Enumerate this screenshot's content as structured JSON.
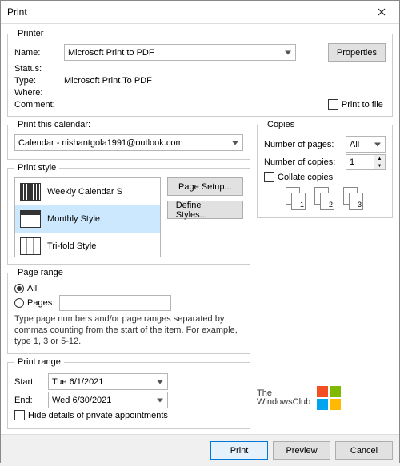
{
  "title": "Print",
  "printer": {
    "legend": "Printer",
    "name_label": "Name:",
    "name_value": "Microsoft Print to PDF",
    "properties_label": "Properties",
    "status_label": "Status:",
    "status_value": "",
    "type_label": "Type:",
    "type_value": "Microsoft Print To PDF",
    "where_label": "Where:",
    "where_value": "",
    "comment_label": "Comment:",
    "comment_value": "",
    "print_to_file_label": "Print to file"
  },
  "calendar": {
    "legend": "Print this calendar:",
    "value": "Calendar - nishantgola1991@outlook.com"
  },
  "print_style": {
    "legend": "Print style",
    "items": [
      {
        "label": "Weekly Calendar S",
        "icon": "cal"
      },
      {
        "label": "Monthly Style",
        "icon": "month"
      },
      {
        "label": "Tri-fold Style",
        "icon": "tri"
      }
    ],
    "selected_index": 1,
    "page_setup_label": "Page Setup...",
    "define_styles_label": "Define Styles..."
  },
  "page_range": {
    "legend": "Page range",
    "all_label": "All",
    "pages_label": "Pages:",
    "pages_value": "",
    "help_text": "Type page numbers and/or page ranges separated by commas counting from the start of the item.  For example, type 1, 3 or 5-12."
  },
  "print_range": {
    "legend": "Print range",
    "start_label": "Start:",
    "start_value": "Tue 6/1/2021",
    "end_label": "End:",
    "end_value": "Wed 6/30/2021",
    "hide_details_label": "Hide details of private appointments"
  },
  "copies": {
    "legend": "Copies",
    "num_pages_label": "Number of pages:",
    "num_pages_value": "All",
    "num_copies_label": "Number of copies:",
    "num_copies_value": "1",
    "collate_label": "Collate copies",
    "collate_pages": [
      "1",
      "1",
      "2",
      "2",
      "3",
      "3"
    ]
  },
  "watermark": {
    "line1": "The",
    "line2": "WindowsClub"
  },
  "footer": {
    "print": "Print",
    "preview": "Preview",
    "cancel": "Cancel"
  }
}
